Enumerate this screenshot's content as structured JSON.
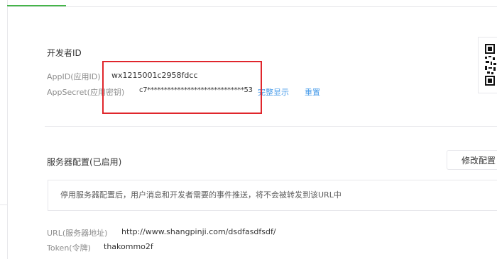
{
  "developer": {
    "title": "开发者ID",
    "appid_label": "AppID(应用ID)",
    "appid_value": "wx1215001c2958fdcc",
    "appsecret_label": "AppSecret(应用密钥)",
    "appsecret_value": "c7*****************************53",
    "show_full_link": "完整显示",
    "reset_link": "重置"
  },
  "server": {
    "title": "服务器配置(已启用)",
    "modify_button": "修改配置",
    "notice": "停用服务器配置后，用户消息和开发者需要的事件推送，将不会被转发到该URL中",
    "url_label": "URL(服务器地址)",
    "url_value": "http://www.shangpinji.com/dsdfasdfsdf/",
    "token_label": "Token(令牌)",
    "token_value": "thakommo2f"
  },
  "colors": {
    "accent_green": "#44b549",
    "link_blue": "#459ae9",
    "highlight_red": "#e0262c"
  }
}
